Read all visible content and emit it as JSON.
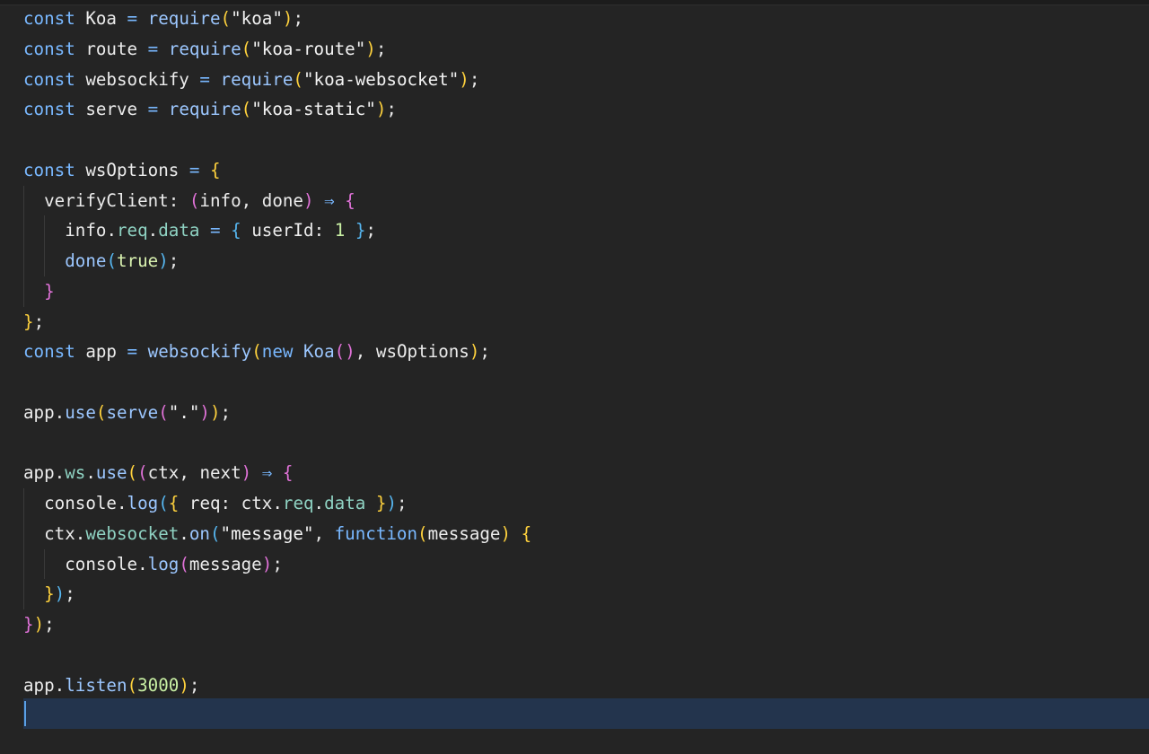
{
  "editor": {
    "language": "javascript",
    "cursor_line": 24,
    "lines": [
      "const Koa = require(\"koa\");",
      "const route = require(\"koa-route\");",
      "const websockify = require(\"koa-websocket\");",
      "const serve = require(\"koa-static\");",
      "",
      "const wsOptions = {",
      "  verifyClient: (info, done) ⇒ {",
      "    info.req.data = { userId: 1 };",
      "    done(true);",
      "  }",
      "};",
      "const app = websockify(new Koa(), wsOptions);",
      "",
      "app.use(serve(\".\"));",
      "",
      "app.ws.use((ctx, next) ⇒ {",
      "  console.log({ req: ctx.req.data });",
      "  ctx.websocket.on(\"message\", function(message) {",
      "    console.log(message);",
      "  });",
      "});",
      "",
      "app.listen(3000);",
      ""
    ]
  },
  "colors": {
    "background": "#242424",
    "keyword": "#79b8ff",
    "bracket_level_1": "#ffd23d",
    "bracket_level_2": "#e072d8",
    "bracket_level_3": "#56b6f0",
    "current_line": "#23344d"
  }
}
